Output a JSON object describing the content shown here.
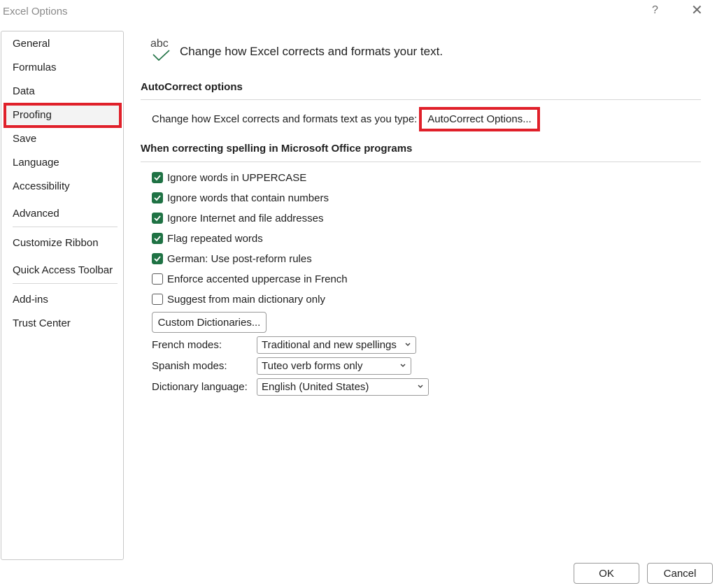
{
  "window": {
    "title": "Excel Options",
    "help_label": "?",
    "close_label": "✕"
  },
  "nav": {
    "items": [
      {
        "label": "General"
      },
      {
        "label": "Formulas"
      },
      {
        "label": "Data"
      },
      {
        "label": "Proofing",
        "selected": true
      },
      {
        "label": "Save"
      },
      {
        "label": "Language"
      },
      {
        "label": "Accessibility"
      },
      {
        "label": "Advanced"
      },
      {
        "label": "Customize Ribbon"
      },
      {
        "label": "Quick Access Toolbar"
      },
      {
        "label": "Add-ins"
      },
      {
        "label": "Trust Center"
      }
    ]
  },
  "header": {
    "icon_text": "abc",
    "text": "Change how Excel corrects and formats your text."
  },
  "autocorrect": {
    "title": "AutoCorrect options",
    "description": "Change how Excel corrects and formats text as you type:",
    "button_label": "AutoCorrect Options..."
  },
  "spelling": {
    "title": "When correcting spelling in Microsoft Office programs",
    "options": [
      {
        "label": "Ignore words in UPPERCASE",
        "checked": true
      },
      {
        "label": "Ignore words that contain numbers",
        "checked": true
      },
      {
        "label": "Ignore Internet and file addresses",
        "checked": true
      },
      {
        "label": "Flag repeated words",
        "checked": true
      },
      {
        "label": "German: Use post-reform rules",
        "checked": true
      },
      {
        "label": "Enforce accented uppercase in French",
        "checked": false
      },
      {
        "label": "Suggest from main dictionary only",
        "checked": false
      }
    ],
    "custom_dict_label": "Custom Dictionaries...",
    "french_modes": {
      "label": "French modes:",
      "value": "Traditional and new spellings"
    },
    "spanish_modes": {
      "label": "Spanish modes:",
      "value": "Tuteo verb forms only"
    },
    "dictionary_language": {
      "label": "Dictionary language:",
      "value": "English (United States)"
    }
  },
  "footer": {
    "ok_label": "OK",
    "cancel_label": "Cancel"
  },
  "colors": {
    "accent_green": "#1f7244",
    "highlight_red": "#e0202a"
  }
}
